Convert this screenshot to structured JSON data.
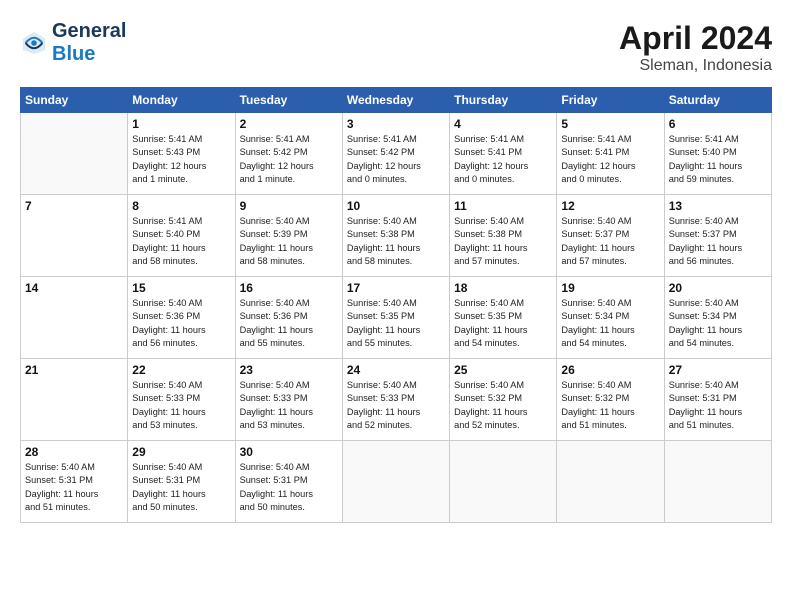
{
  "header": {
    "logo_line1": "General",
    "logo_line2": "Blue",
    "month_year": "April 2024",
    "location": "Sleman, Indonesia"
  },
  "calendar": {
    "weekdays": [
      "Sunday",
      "Monday",
      "Tuesday",
      "Wednesday",
      "Thursday",
      "Friday",
      "Saturday"
    ],
    "weeks": [
      [
        {
          "day": "",
          "info": ""
        },
        {
          "day": "1",
          "info": "Sunrise: 5:41 AM\nSunset: 5:43 PM\nDaylight: 12 hours\nand 1 minute."
        },
        {
          "day": "2",
          "info": "Sunrise: 5:41 AM\nSunset: 5:42 PM\nDaylight: 12 hours\nand 1 minute."
        },
        {
          "day": "3",
          "info": "Sunrise: 5:41 AM\nSunset: 5:42 PM\nDaylight: 12 hours\nand 0 minutes."
        },
        {
          "day": "4",
          "info": "Sunrise: 5:41 AM\nSunset: 5:41 PM\nDaylight: 12 hours\nand 0 minutes."
        },
        {
          "day": "5",
          "info": "Sunrise: 5:41 AM\nSunset: 5:41 PM\nDaylight: 12 hours\nand 0 minutes."
        },
        {
          "day": "6",
          "info": "Sunrise: 5:41 AM\nSunset: 5:40 PM\nDaylight: 11 hours\nand 59 minutes."
        }
      ],
      [
        {
          "day": "7",
          "info": ""
        },
        {
          "day": "8",
          "info": "Sunrise: 5:41 AM\nSunset: 5:40 PM\nDaylight: 11 hours\nand 58 minutes."
        },
        {
          "day": "9",
          "info": "Sunrise: 5:40 AM\nSunset: 5:39 PM\nDaylight: 11 hours\nand 58 minutes."
        },
        {
          "day": "10",
          "info": "Sunrise: 5:40 AM\nSunset: 5:38 PM\nDaylight: 11 hours\nand 58 minutes."
        },
        {
          "day": "11",
          "info": "Sunrise: 5:40 AM\nSunset: 5:38 PM\nDaylight: 11 hours\nand 57 minutes."
        },
        {
          "day": "12",
          "info": "Sunrise: 5:40 AM\nSunset: 5:37 PM\nDaylight: 11 hours\nand 57 minutes."
        },
        {
          "day": "13",
          "info": "Sunrise: 5:40 AM\nSunset: 5:37 PM\nDaylight: 11 hours\nand 56 minutes."
        }
      ],
      [
        {
          "day": "14",
          "info": ""
        },
        {
          "day": "15",
          "info": "Sunrise: 5:40 AM\nSunset: 5:36 PM\nDaylight: 11 hours\nand 56 minutes."
        },
        {
          "day": "16",
          "info": "Sunrise: 5:40 AM\nSunset: 5:36 PM\nDaylight: 11 hours\nand 55 minutes."
        },
        {
          "day": "17",
          "info": "Sunrise: 5:40 AM\nSunset: 5:35 PM\nDaylight: 11 hours\nand 55 minutes."
        },
        {
          "day": "18",
          "info": "Sunrise: 5:40 AM\nSunset: 5:35 PM\nDaylight: 11 hours\nand 54 minutes."
        },
        {
          "day": "19",
          "info": "Sunrise: 5:40 AM\nSunset: 5:34 PM\nDaylight: 11 hours\nand 54 minutes."
        },
        {
          "day": "20",
          "info": "Sunrise: 5:40 AM\nSunset: 5:34 PM\nDaylight: 11 hours\nand 54 minutes."
        }
      ],
      [
        {
          "day": "21",
          "info": ""
        },
        {
          "day": "22",
          "info": "Sunrise: 5:40 AM\nSunset: 5:33 PM\nDaylight: 11 hours\nand 53 minutes."
        },
        {
          "day": "23",
          "info": "Sunrise: 5:40 AM\nSunset: 5:33 PM\nDaylight: 11 hours\nand 53 minutes."
        },
        {
          "day": "24",
          "info": "Sunrise: 5:40 AM\nSunset: 5:33 PM\nDaylight: 11 hours\nand 52 minutes."
        },
        {
          "day": "25",
          "info": "Sunrise: 5:40 AM\nSunset: 5:32 PM\nDaylight: 11 hours\nand 52 minutes."
        },
        {
          "day": "26",
          "info": "Sunrise: 5:40 AM\nSunset: 5:32 PM\nDaylight: 11 hours\nand 51 minutes."
        },
        {
          "day": "27",
          "info": "Sunrise: 5:40 AM\nSunset: 5:31 PM\nDaylight: 11 hours\nand 51 minutes."
        }
      ],
      [
        {
          "day": "28",
          "info": "Sunrise: 5:40 AM\nSunset: 5:31 PM\nDaylight: 11 hours\nand 51 minutes."
        },
        {
          "day": "29",
          "info": "Sunrise: 5:40 AM\nSunset: 5:31 PM\nDaylight: 11 hours\nand 50 minutes."
        },
        {
          "day": "30",
          "info": "Sunrise: 5:40 AM\nSunset: 5:31 PM\nDaylight: 11 hours\nand 50 minutes."
        },
        {
          "day": "",
          "info": ""
        },
        {
          "day": "",
          "info": ""
        },
        {
          "day": "",
          "info": ""
        },
        {
          "day": "",
          "info": ""
        }
      ]
    ]
  }
}
